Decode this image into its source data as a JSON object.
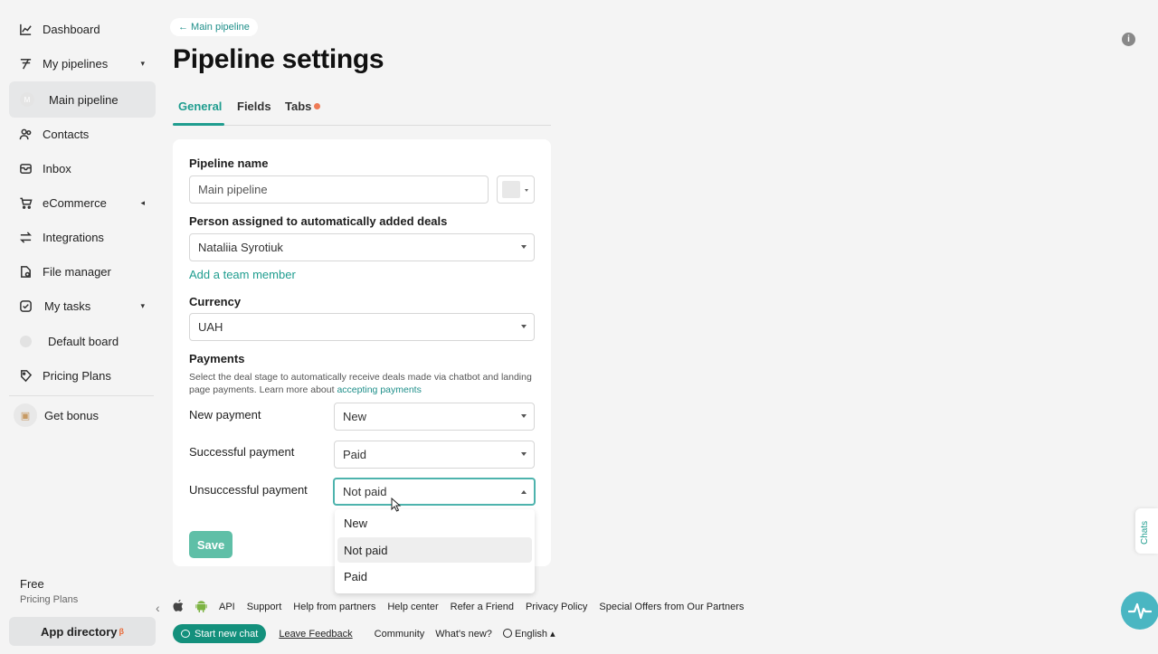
{
  "sidebar": {
    "items": [
      {
        "label": "Dashboard",
        "icon": "chart-line-icon"
      },
      {
        "label": "My pipelines",
        "icon": "pipeline-icon"
      },
      {
        "label": "Main pipeline",
        "avatar": "M"
      },
      {
        "label": "Contacts",
        "icon": "contacts-icon"
      },
      {
        "label": "Inbox",
        "icon": "inbox-icon"
      },
      {
        "label": "eCommerce",
        "icon": "cart-icon"
      },
      {
        "label": "Integrations",
        "icon": "integrations-icon"
      },
      {
        "label": "File manager",
        "icon": "file-icon"
      },
      {
        "label": "My tasks",
        "icon": "tasks-icon"
      },
      {
        "label": "Default board",
        "icon": "dot-icon"
      },
      {
        "label": "Pricing Plans",
        "icon": "tag-icon"
      },
      {
        "label": "Get bonus",
        "icon": "gift-icon"
      }
    ],
    "plan_name": "Free",
    "plan_link": "Pricing Plans",
    "app_directory": "App directory",
    "app_directory_badge": "β"
  },
  "header": {
    "back_link": "← Main pipeline",
    "title": "Pipeline settings"
  },
  "tabs": [
    {
      "label": "General",
      "active": true
    },
    {
      "label": "Fields"
    },
    {
      "label": "Tabs"
    }
  ],
  "form": {
    "pipeline_name_label": "Pipeline name",
    "pipeline_name_value": "Main pipeline",
    "assignee_label": "Person assigned to automatically added deals",
    "assignee_value": "Nataliia Syrotiuk",
    "add_member_link": "Add a team member",
    "currency_label": "Currency",
    "currency_value": "UAH",
    "payments_label": "Payments",
    "payments_desc": "Select the deal stage to automatically receive deals made via chatbot and landing page payments. Learn more about",
    "payments_desc_link": "accepting payments",
    "new_payment_label": "New payment",
    "new_payment_value": "New",
    "successful_payment_label": "Successful payment",
    "successful_payment_value": "Paid",
    "unsuccessful_payment_label": "Unsuccessful payment",
    "unsuccessful_payment_value": "Not paid",
    "save_label": "Save"
  },
  "dropdown": {
    "options": [
      "New",
      "Not paid",
      "Paid"
    ],
    "hovered": "Not paid"
  },
  "footer": {
    "links_row1": [
      "API",
      "Support",
      "Help from partners",
      "Help center",
      "Refer a Friend",
      "Privacy Policy",
      "Special Offers from Our Partners"
    ],
    "start_chat": "Start new chat",
    "feedback": "Leave Feedback",
    "community": "Community",
    "whats_new": "What's new?",
    "language": "English"
  },
  "widgets": {
    "chats_tab": "Chats"
  },
  "colors": {
    "accent": "#1f9d8f",
    "save_button": "#5fbfa7",
    "tab_dot": "#ee7b56",
    "chat_button": "#13907c",
    "pulse_button": "#4ab6c2"
  }
}
